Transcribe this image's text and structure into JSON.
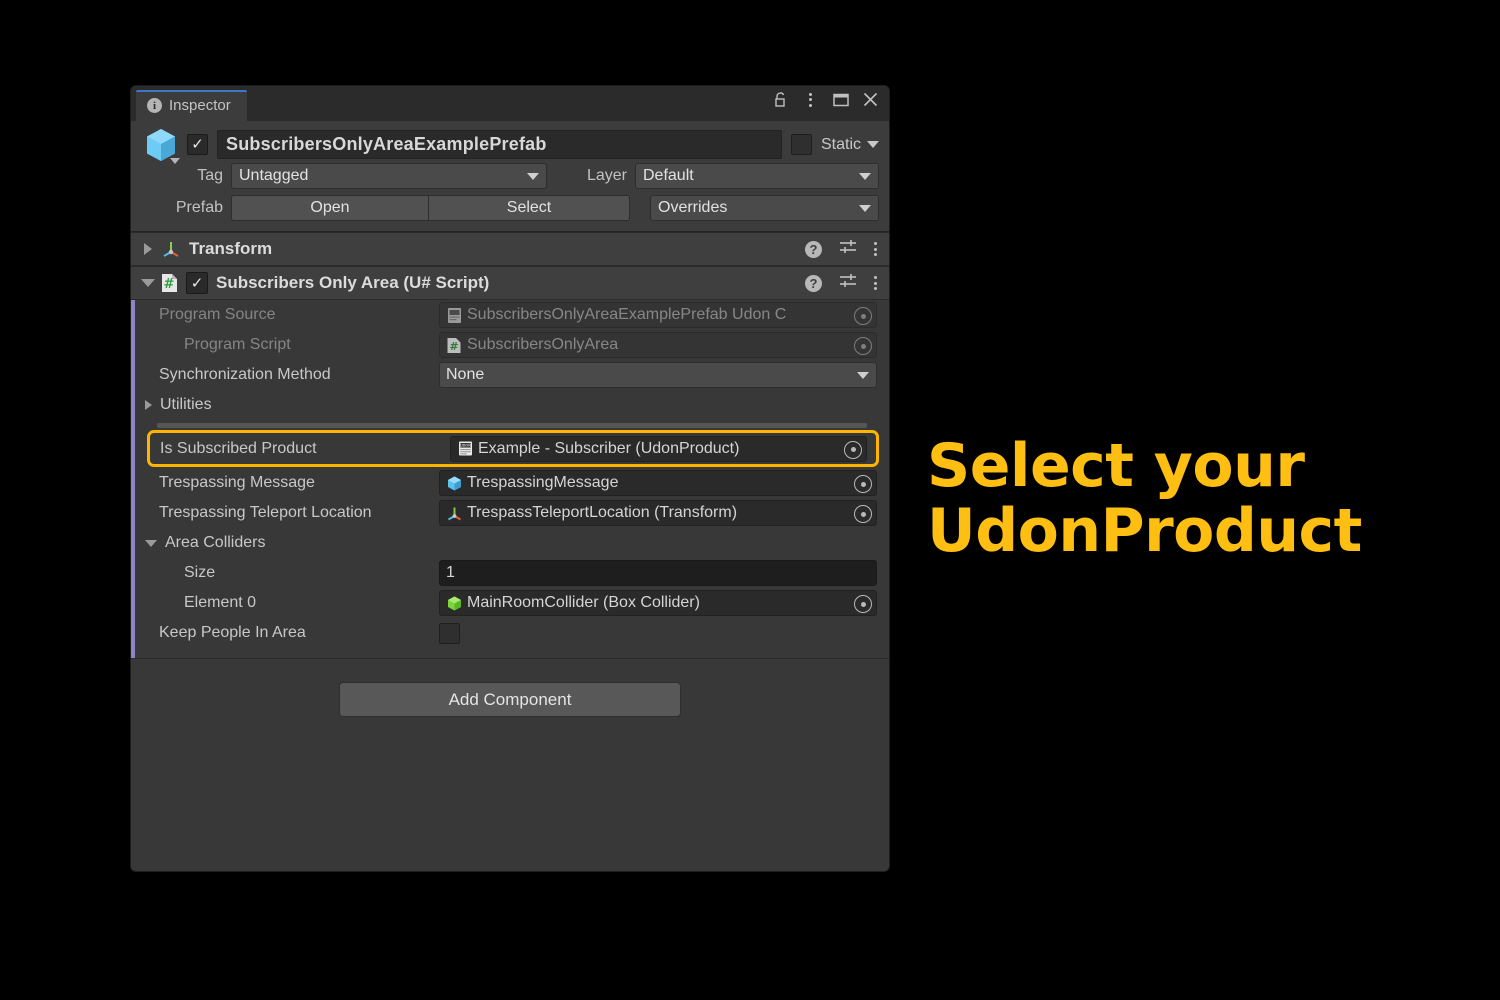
{
  "window": {
    "tab_label": "Inspector",
    "tab_icon": "info-icon",
    "controls": [
      {
        "name": "lock-icon",
        "glyph": "lock"
      },
      {
        "name": "kebab-menu-icon",
        "glyph": "kebab"
      },
      {
        "name": "maximize-icon",
        "glyph": "maximize"
      },
      {
        "name": "close-icon",
        "glyph": "close"
      }
    ]
  },
  "gameobject": {
    "enabled_checkmark": "✓",
    "name": "SubscribersOnlyAreaExamplePrefab",
    "static_label": "Static",
    "tag_label": "Tag",
    "tag_value": "Untagged",
    "layer_label": "Layer",
    "layer_value": "Default",
    "prefab_label": "Prefab",
    "prefab_open": "Open",
    "prefab_select": "Select",
    "prefab_overrides": "Overrides"
  },
  "components": [
    {
      "name": "Transform",
      "expanded": false,
      "icon": "transform-axis-icon",
      "has_enable_checkbox": false
    },
    {
      "name": "Subscribers Only Area (U# Script)",
      "expanded": true,
      "icon": "usharp-script-icon",
      "has_enable_checkbox": true,
      "enabled_checkmark": "✓"
    }
  ],
  "properties": {
    "program_source": {
      "label": "Program Source",
      "value": "SubscribersOnlyAreaExamplePrefab Udon C",
      "icon": "udon-program-asset-icon",
      "disabled": true
    },
    "program_script": {
      "label": "Program Script",
      "value": "SubscribersOnlyArea",
      "icon": "usharp-script-icon",
      "disabled": true
    },
    "synchronization_method": {
      "label": "Synchronization Method",
      "value": "None"
    },
    "utilities": {
      "label": "Utilities",
      "expanded": false
    },
    "is_subscribed_product": {
      "label": "Is Subscribed Product",
      "value": "Example - Subscriber (UdonProduct)",
      "icon": "udon-product-icon",
      "highlighted": true
    },
    "trespassing_message": {
      "label": "Trespassing Message",
      "value": "TrespassingMessage",
      "icon": "prefab-cube-icon"
    },
    "trespassing_teleport_location": {
      "label": "Trespassing Teleport Location",
      "value": "TrespassTeleportLocation (Transform)",
      "icon": "transform-axis-icon"
    },
    "area_colliders": {
      "label": "Area Colliders",
      "expanded": true,
      "size_label": "Size",
      "size_value": "1",
      "element0_label": "Element 0",
      "element0_value": "MainRoomCollider (Box Collider)",
      "element0_icon": "gameobject-green-cube-icon"
    },
    "keep_people_in_area": {
      "label": "Keep People In Area",
      "checked": false
    }
  },
  "footer": {
    "add_component_label": "Add Component"
  },
  "annotation": {
    "line1": "Select your",
    "line2": "UdonProduct",
    "text_color": "#ffbe12",
    "background_color": "#000000"
  },
  "colors": {
    "highlight_border": "#ffb400",
    "panel_background": "#383838",
    "tab_accent": "#3c79c8",
    "prefab_override_bar": "#9085c4"
  }
}
